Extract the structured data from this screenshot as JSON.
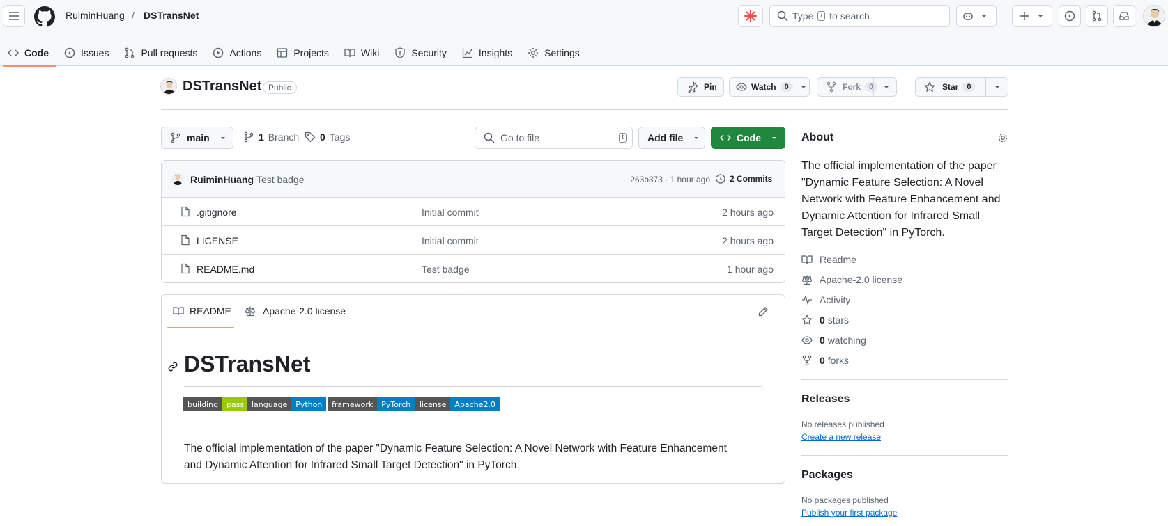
{
  "header": {
    "owner": "RuiminHuang",
    "separator": "/",
    "repo": "DSTransNet",
    "search_pre": "Type",
    "search_key": "/",
    "search_post": "to search"
  },
  "tabs": [
    {
      "label": "Code"
    },
    {
      "label": "Issues"
    },
    {
      "label": "Pull requests"
    },
    {
      "label": "Actions"
    },
    {
      "label": "Projects"
    },
    {
      "label": "Wiki"
    },
    {
      "label": "Security"
    },
    {
      "label": "Insights"
    },
    {
      "label": "Settings"
    }
  ],
  "repo_head": {
    "name": "DSTransNet",
    "visibility": "Public",
    "pin": "Pin",
    "watch": "Watch",
    "watch_count": "0",
    "fork": "Fork",
    "fork_count": "0",
    "star": "Star",
    "star_count": "0"
  },
  "file_nav": {
    "branch": "main",
    "branches_count": "1",
    "branches_label": "Branch",
    "tags_count": "0",
    "tags_label": "Tags",
    "goto_placeholder": "Go to file",
    "goto_key": "t",
    "add_file": "Add file",
    "code": "Code"
  },
  "commit": {
    "author": "RuiminHuang",
    "message": "Test badge",
    "meta": "263b373 · 1 hour ago",
    "commits": "2 Commits"
  },
  "files": [
    {
      "name": ".gitignore",
      "message": "Initial commit",
      "time": "2 hours ago"
    },
    {
      "name": "LICENSE",
      "message": "Initial commit",
      "time": "2 hours ago"
    },
    {
      "name": "README.md",
      "message": "Test badge",
      "time": "1 hour ago"
    }
  ],
  "readme": {
    "tab_readme": "README",
    "tab_license": "Apache-2.0 license",
    "title": "DSTransNet",
    "badges": [
      {
        "label": "building",
        "value": "pass",
        "color": "#97ca00"
      },
      {
        "label": "language",
        "value": "Python",
        "color": "#007ec6"
      },
      {
        "label": "framework",
        "value": "PyTorch",
        "color": "#007ec6"
      },
      {
        "label": "license",
        "value": "Apache2.0",
        "color": "#007ec6"
      }
    ],
    "body_line1": "The official implementation of the paper \"Dynamic Feature Selection: A Novel Network with Feature Enhancement",
    "body_line2": "and Dynamic Attention for Infrared Small Target Detection\" in PyTorch."
  },
  "about": {
    "title": "About",
    "desc_lines": [
      "The official implementation of the paper",
      "\"Dynamic Feature Selection: A Novel",
      "Network with Feature Enhancement and",
      "Dynamic Attention for Infrared Small",
      "Target Detection\" in PyTorch."
    ],
    "readme": "Readme",
    "license": "Apache-2.0 license",
    "activity": "Activity",
    "stars_count": "0",
    "stars_label": "stars",
    "watching_count": "0",
    "watching_label": "watching",
    "forks_count": "0",
    "forks_label": "forks"
  },
  "releases": {
    "title": "Releases",
    "none": "No releases published",
    "create": "Create a new release"
  },
  "packages": {
    "title": "Packages",
    "none": "No packages published",
    "publish": "Publish your first package"
  },
  "colors": {
    "accent_tab": "#fd8c73",
    "code_button": "#1f883d",
    "link": "#0969da"
  }
}
